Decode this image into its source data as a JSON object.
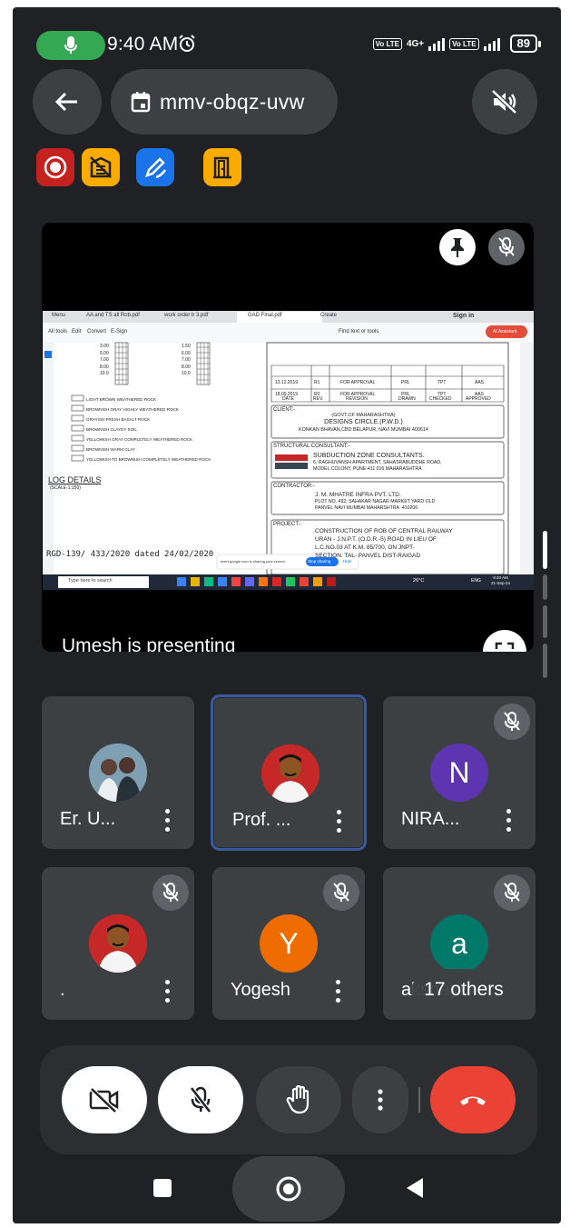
{
  "status_bar": {
    "time": "9:40 AM",
    "network_1": "Vo LTE",
    "network_type": "4G+",
    "network_2": "Vo LTE",
    "battery": "89"
  },
  "header": {
    "meeting_code": "mmv-obqz-uvw"
  },
  "colors": {
    "background": "#202124",
    "tile": "#3c4043",
    "record_red": "#c5221f",
    "activity_yellow": "#f9ab00",
    "whiteboard_blue": "#1a73e8",
    "end_call_red": "#ea4335",
    "active_border": "#3b5998"
  },
  "presentation": {
    "label": "Umesh is presenting",
    "shared_screen": {
      "tabs": [
        "Menu",
        "AA and TS all Rob.pdf",
        "work order lr 3.pdf",
        "GAD Final.pdf",
        "Create"
      ],
      "sign_in": "Sign in",
      "toolbar": [
        "All tools",
        "Edit",
        "Convert",
        "E-Sign"
      ],
      "find_text": "Find text or tools",
      "ai_assistant": "AI Assistant",
      "depth_values_a": [
        "3.00",
        "6.00",
        "7.00",
        "8.00",
        "10.0"
      ],
      "depth_values_b": [
        "1.50",
        "6.00",
        "7.00",
        "8.00",
        "10.0"
      ],
      "legend": [
        "LIGHT BROWN WEATHERED ROCK",
        "BROWNISH GRAY HIGHLY WEATHERED ROCK",
        "GRAYISH FRESH BASALT ROCK",
        "BROWNISH CLAYEY SOIL",
        "YELLOWISH GRAY COMPLETELY WEATHERED ROCK",
        "BROWNISH WARM CLAY",
        "YELLOWISH TO BROWNISH COMPLETELY WEATHERED ROCK"
      ],
      "log_title": "LOG DETAILS",
      "log_scale": "(SCALE-1:150)",
      "drawing_ref": "RGD-139/ 433/2020 dated 24/02/2020",
      "revision_rows": [
        [
          "13.12.2019",
          "R1",
          "FOR APPROVAL",
          "PRL",
          "TPT",
          "AAS"
        ],
        [
          "18.09.2019",
          "R0",
          "FOR APPROVAL",
          "PRL",
          "TPT",
          "AAS"
        ]
      ],
      "revision_headers": [
        "DATE",
        "REV.",
        "REVISION",
        "DRAWN",
        "CHECKED",
        "APPROVED"
      ],
      "client_label": "CLIENT:-",
      "client_lines": [
        "(GOVT.OF MAHARASHTRA)",
        "DESIGNS CIRCLE,(P.W.D.)",
        "KONKAN BHAVAN,CBD BELAPUR, NAVI MUMBAI 400614"
      ],
      "consultant_label": "STRUCTURAL CONSULTANT:-",
      "consultant_lines": [
        "SUBDUCTION ZONE CONSULTANTS.",
        "6, RAGHUVANSH APARTMENT, SAHASRABUDDHE ROAD,",
        "MODEL COLONY, PUNE-411 016 MAHARASHTRA"
      ],
      "contractor_label": "CONTRACTOR:-",
      "contractor_lines": [
        "J. M. MHATRE INFRA PVT. LTD.",
        "PLOT NO. 492, SAHAKAR NAGAR MARKET YARD OLD",
        "PANVEL NAVI MUMBAI MAHARSHTRA -410206"
      ],
      "project_label": "PROJECT:-",
      "project_lines": [
        "CONSTRUCTION OF ROB OF CENTRAL RAILWAY",
        "URAN - J.N.P.T. (O.D.R.-5) ROAD IN LIEU OF",
        "L.C.NO.03 AT K.M. 85/700, ON JNPT-",
        "SECTION. TAL- PANVEL DIST-RAIGAD"
      ],
      "sharing_notice": "meet.google.com is sharing your screen.",
      "stop_sharing": "Stop sharing",
      "hide": "Hide",
      "taskbar_search": "Type here to search",
      "weather": "26°C",
      "lang": "ENG",
      "clock_time": "9:40 AM",
      "clock_date": "21-Sep-24"
    }
  },
  "participants": [
    {
      "name": "Er. U...",
      "initial": "",
      "avatar_color": "#6d8fa3",
      "muted": false,
      "active": false
    },
    {
      "name": "Prof. ...",
      "initial": "",
      "avatar_color": "#c62828",
      "muted": false,
      "active": true
    },
    {
      "name": "NIRA...",
      "initial": "N",
      "avatar_color": "#5e35b1",
      "muted": true,
      "active": false
    },
    {
      "name": ".",
      "initial": "",
      "avatar_color": "#c62828",
      "muted": true,
      "active": false
    },
    {
      "name": "Yogesh",
      "initial": "Y",
      "avatar_color": "#ef6c00",
      "muted": true,
      "active": false
    },
    {
      "name": "akshay",
      "initial": "a",
      "avatar_color": "#00796b",
      "muted": true,
      "active": false
    }
  ],
  "others_count": "17 others",
  "icons": {
    "status_mic": "mic-icon",
    "alarm": "alarm-icon",
    "back": "arrow-left-icon",
    "calendar": "calendar-icon",
    "speaker_off": "speaker-off-icon",
    "record": "record-icon",
    "activities": "activities-icon",
    "whiteboard": "whiteboard-icon",
    "leave_room": "door-icon",
    "pin": "pin-icon",
    "fullscreen": "fullscreen-icon",
    "camera_off": "camera-off-icon",
    "mic_off": "mic-off-icon",
    "raise_hand": "hand-icon",
    "more": "more-vertical-icon",
    "end_call": "end-call-icon",
    "nav_recents": "square-icon",
    "nav_home": "circle-icon",
    "nav_back": "triangle-back-icon"
  }
}
